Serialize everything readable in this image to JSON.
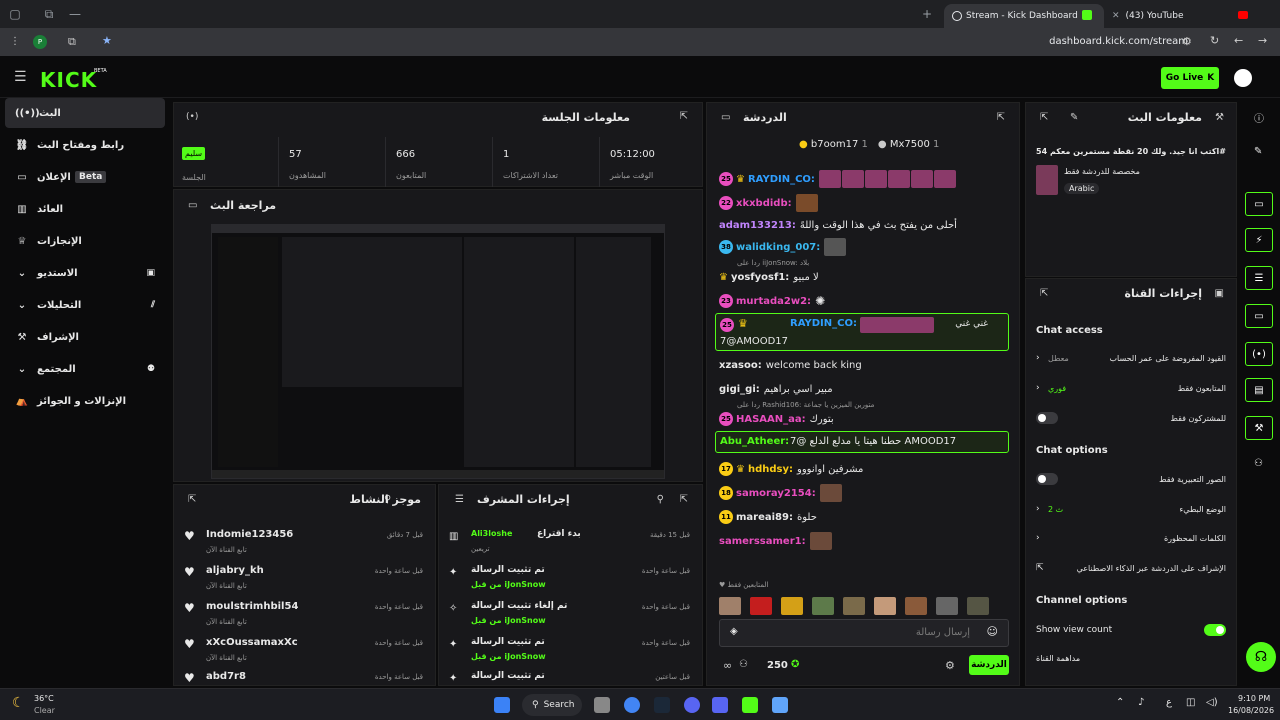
{
  "browser": {
    "tabs": [
      {
        "label": "Stream - Kick Dashboard"
      },
      {
        "label": "(43) YouTube"
      }
    ],
    "url": "dashboard.kick.com/stream",
    "new_tab": "+"
  },
  "header": {
    "logo": "KICK",
    "logo_sup": "BETA",
    "go_live": "Go Live"
  },
  "sidebar": {
    "items": [
      {
        "label": "البث",
        "icon": "live-icon"
      },
      {
        "label": "رابط ومفتاح البث",
        "icon": "link-icon"
      },
      {
        "label": "الإعلان",
        "badge": "Beta",
        "icon": "ad-icon"
      },
      {
        "label": "العائد",
        "icon": "revenue-icon"
      },
      {
        "label": "الإنجازات",
        "icon": "trophy-icon"
      },
      {
        "label": "الاستديو",
        "icon": "studio-icon"
      },
      {
        "label": "التحليلات",
        "icon": "analytics-icon"
      },
      {
        "label": "الإشراف",
        "icon": "moderation-icon"
      },
      {
        "label": "المجتمع",
        "icon": "community-icon"
      },
      {
        "label": "الإنزالات و الجوائز",
        "icon": "drops-icon"
      }
    ]
  },
  "session": {
    "title": "معلومات الجلسة",
    "badge": "سليم",
    "session_label": "الجلسة",
    "stats": [
      {
        "value": "57",
        "label": "المشاهدون"
      },
      {
        "value": "666",
        "label": "المتابعون"
      },
      {
        "value": "1",
        "label": "تعداد الاشتراكات"
      },
      {
        "value": "05:12:00",
        "label": "الوقت مباشر"
      }
    ]
  },
  "preview": {
    "title": "مراجعة البث"
  },
  "activity": {
    "title": "موجز النشاط",
    "rows": [
      {
        "name": "Indomie123456",
        "sub": "تابع القناة الآن",
        "time": "قبل 7 دقائق"
      },
      {
        "name": "aljabry_kh",
        "sub": "تابع القناة الآن",
        "time": "قبل ساعة واحدة"
      },
      {
        "name": "moulstrimhbil54",
        "sub": "تابع القناة الآن",
        "time": "قبل ساعة واحدة"
      },
      {
        "name": "xXcOussamaxXc",
        "sub": "تابع القناة الآن",
        "time": "قبل ساعة واحدة"
      },
      {
        "name": "abd7r8",
        "sub": "",
        "time": "قبل ساعة واحدة"
      }
    ]
  },
  "modactions": {
    "title": "إجراءات المشرف",
    "rows": [
      {
        "head": "بدء اقتراع",
        "user": "Ali3loshe",
        "extra": "تريعين",
        "time": "قبل 15 دقيقة"
      },
      {
        "head": "تم تثبيت الرسالة",
        "user": "من قبل iJonSnow",
        "time": "قبل ساعة واحدة"
      },
      {
        "head": "تم إلغاء تثبيت الرسالة",
        "user": "من قبل iJonSnow",
        "time": "قبل ساعة واحدة"
      },
      {
        "head": "تم تثبيت الرسالة",
        "user": "من قبل iJonSnow",
        "time": "قبل ساعة واحدة"
      },
      {
        "head": "تم تثبيت الرسالة",
        "user": "",
        "time": "قبل ساعتين"
      }
    ]
  },
  "chat": {
    "title": "الدردشة",
    "top_gifters": [
      {
        "name": "b7oom17",
        "count": "1"
      },
      {
        "name": "Mx7500",
        "count": "1"
      }
    ],
    "messages": [
      {
        "badge": "25",
        "badge_color": "#e94ebf",
        "user": "RAYDIN_CO:",
        "user_color": "#2f9eff",
        "text": ""
      },
      {
        "badge": "22",
        "badge_color": "#e94ebf",
        "user": "xkxbdidb:",
        "user_color": "#e94ebf",
        "text": ""
      },
      {
        "badge": "",
        "badge_color": "",
        "user": "adam133213:",
        "user_color": "#c084fc",
        "text": "أحلى من يفتح بث في هذا الوقت واللهً"
      },
      {
        "badge": "38",
        "badge_color": "#3ab8f0",
        "user": "walidking_007:",
        "user_color": "#3ab8f0",
        "text": ""
      },
      {
        "badge": "",
        "badge_color": "",
        "user": "yosfyosf1:",
        "user_color": "#f5f5f5",
        "text": "لا مبيو"
      },
      {
        "badge": "23",
        "badge_color": "#e94ebf",
        "user": "murtada2w2:",
        "user_color": "#e94ebf",
        "text": ""
      },
      {
        "badge": "",
        "badge_color": "",
        "user": "xzasoo:",
        "user_color": "#f5f5f5",
        "text": "welcome back king"
      },
      {
        "badge": "",
        "badge_color": "",
        "user": "gigi_gi:",
        "user_color": "#f5f5f5",
        "text": "مبير اسي براهيم"
      },
      {
        "badge": "25",
        "badge_color": "#e94ebf",
        "user": "HASAAN_aa:",
        "user_color": "#e94ebf",
        "text": "بتورك"
      },
      {
        "badge": "17",
        "badge_color": "#facc15",
        "user": "hdhdsy:",
        "user_color": "#facc15",
        "text": "مشرفين اوانووو"
      },
      {
        "badge": "18",
        "badge_color": "#facc15",
        "user": "samoray2154:",
        "user_color": "#e94ebf",
        "text": ""
      },
      {
        "badge": "11",
        "badge_color": "#facc15",
        "user": "mareai89:",
        "user_color": "#f5f5f5",
        "text": "حلوة"
      },
      {
        "badge": "",
        "badge_color": "",
        "user": "samerssamer1:",
        "user_color": "#e94ebf",
        "text": ""
      }
    ],
    "highlight1": {
      "badge": "25",
      "user": "RAYDIN_CO:",
      "text": "7@AMOOD17",
      "extra": "غني غني"
    },
    "highlight2": {
      "user": "Abu_Atheer:",
      "text": "7@ حطنا هيتا يا مدلع الدلع AMOOD17"
    },
    "reply1": "ردا على iiJonSnow: بلاد",
    "reply2": "ردا على Rashid106: متورين الميزين يا جماعة",
    "followers_only": "المتابعين فقط",
    "input_placeholder": "إرسال رسالة",
    "points": "250",
    "send_label": "الدردشة"
  },
  "stream_info": {
    "title": "معلومات البث",
    "stream_title": "اكتب انا جيد. ولك 20 نقطة مستمرين معكم 54#",
    "category": "مخصصة للدردشة فقط",
    "tag": "Arabic"
  },
  "channel_actions": {
    "title": "إجراءات القناة",
    "chat_access": "Chat access",
    "access_rows": [
      {
        "label": "القيود المفروضة على عمر الحساب",
        "value": "معطل"
      },
      {
        "label": "المتابعون فقط",
        "value": "فوري"
      },
      {
        "label": "للمشتركون فقط",
        "value": ""
      }
    ],
    "chat_options": "Chat options",
    "option_rows": [
      {
        "label": "الصور التعبيرية فقط",
        "value": ""
      },
      {
        "label": "الوضع البطيء",
        "value": "2 ث"
      },
      {
        "label": "الكلمات المحظورة",
        "value": ""
      },
      {
        "label": "الإشراف على الدردشة عبر الذكاء الاصطناعي",
        "value": ""
      }
    ],
    "channel_options": "Channel options",
    "show_view_count": "Show view count",
    "raid": "مداهمة القناة"
  },
  "taskbar": {
    "weather_temp": "36°C",
    "weather_desc": "Clear",
    "search": "Search",
    "time": "9:10 PM",
    "date": "16/08/2026"
  }
}
